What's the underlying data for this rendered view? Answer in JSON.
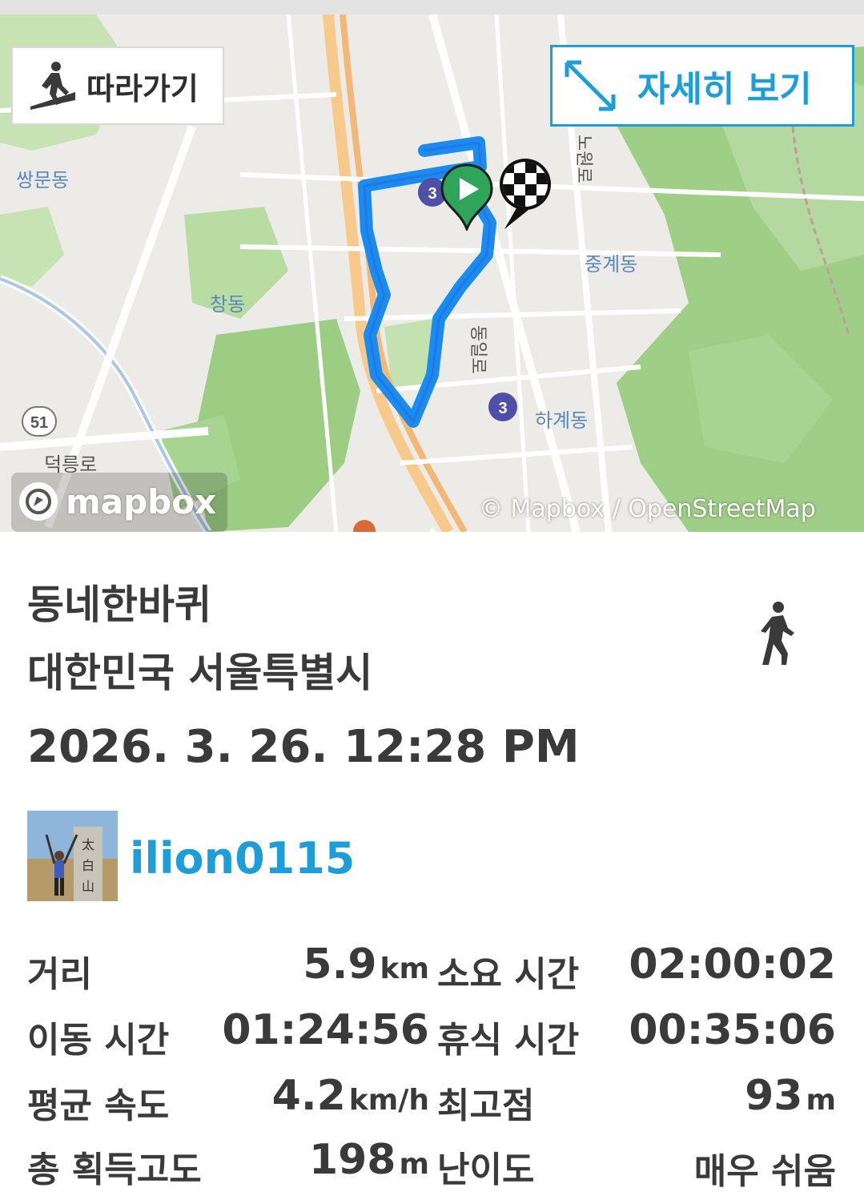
{
  "map": {
    "follow_label": "따라가기",
    "detail_label": "자세히 보기",
    "mapbox_logo": "mapbox",
    "attribution": "© Mapbox / OpenStreetMap",
    "labels": [
      "쌍문동",
      "창동",
      "중계동",
      "하계동",
      "덕릉로",
      "노원로",
      "동일로",
      "51",
      "3",
      "3"
    ],
    "route_color": "#1a8cf0",
    "accent": "#1e9ed8"
  },
  "activity": {
    "title": "동네한바퀴",
    "location": "대한민국 서울특별시",
    "datetime": "2026. 3. 26. 12:28 PM",
    "type_icon": "walking-icon",
    "username": "ilion0115"
  },
  "stats": {
    "distance": {
      "label": "거리",
      "value": "5.9",
      "unit": "km"
    },
    "total_time": {
      "label": "소요 시간",
      "value": "02:00:02",
      "unit": ""
    },
    "moving_time": {
      "label": "이동 시간",
      "value": "01:24:56",
      "unit": ""
    },
    "rest_time": {
      "label": "휴식 시간",
      "value": "00:35:06",
      "unit": ""
    },
    "avg_speed": {
      "label": "평균 속도",
      "value": "4.2",
      "unit": "km/h"
    },
    "max_alt": {
      "label": "최고점",
      "value": "93",
      "unit": "m"
    },
    "elev_gain": {
      "label": "총 획득고도",
      "value": "198",
      "unit": "m"
    },
    "difficulty": {
      "label": "난이도",
      "value": "매우 쉬움",
      "unit": ""
    }
  }
}
